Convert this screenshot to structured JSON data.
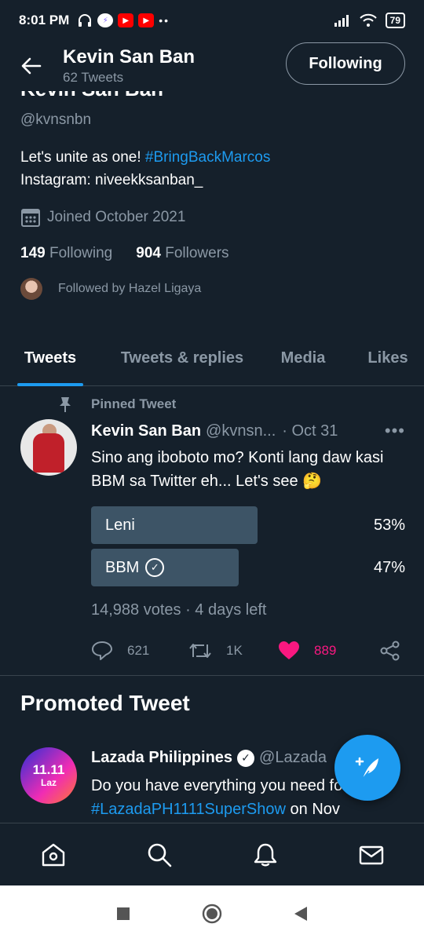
{
  "status_bar": {
    "time": "8:01 PM",
    "battery": "79"
  },
  "header": {
    "name": "Kevin San Ban",
    "tweet_count": "62 Tweets",
    "follow_label": "Following"
  },
  "profile": {
    "name_cut": "Kevin San Ban",
    "handle": "@kvnsnbn",
    "bio_text": "Let's unite as one! ",
    "bio_hashtag": "#BringBackMarcos",
    "bio_line2": "Instagram: niveekksanban_",
    "joined": "Joined October 2021",
    "following_count": "149",
    "following_label": "Following",
    "followers_count": "904",
    "followers_label": "Followers",
    "followed_by": "Followed by Hazel Ligaya"
  },
  "tabs": [
    {
      "label": "Tweets",
      "active": true
    },
    {
      "label": "Tweets & replies",
      "active": false
    },
    {
      "label": "Media",
      "active": false
    },
    {
      "label": "Likes",
      "active": false
    }
  ],
  "pinned_tweet": {
    "pinned_label": "Pinned Tweet",
    "author": "Kevin San Ban",
    "handle": "@kvnsn...",
    "date": "· Oct 31",
    "text": "Sino ang iboboto mo? Konti lang daw kasi BBM sa Twitter eh... Let's see 🤔",
    "poll": [
      {
        "label": "Leni",
        "percent_text": "53%",
        "fraction": 0.53,
        "checked": false
      },
      {
        "label": "BBM",
        "percent_text": "47%",
        "fraction": 0.47,
        "checked": true
      }
    ],
    "poll_meta": "14,988 votes · 4 days left",
    "replies": "621",
    "retweets": "1K",
    "likes": "889"
  },
  "promoted": {
    "section_title": "Promoted Tweet",
    "avatar_big": "11.11",
    "avatar_small": "Laz",
    "author": "Lazada Philippines",
    "handle": "@Lazada",
    "text_1": "Do you have everything you need for the ",
    "hashtag": "#LazadaPH1111SuperShow",
    "text_2": " on Nov"
  },
  "colors": {
    "background": "#15202b",
    "accent": "#1d9bf0",
    "like": "#f91880",
    "muted": "#8b98a5"
  }
}
